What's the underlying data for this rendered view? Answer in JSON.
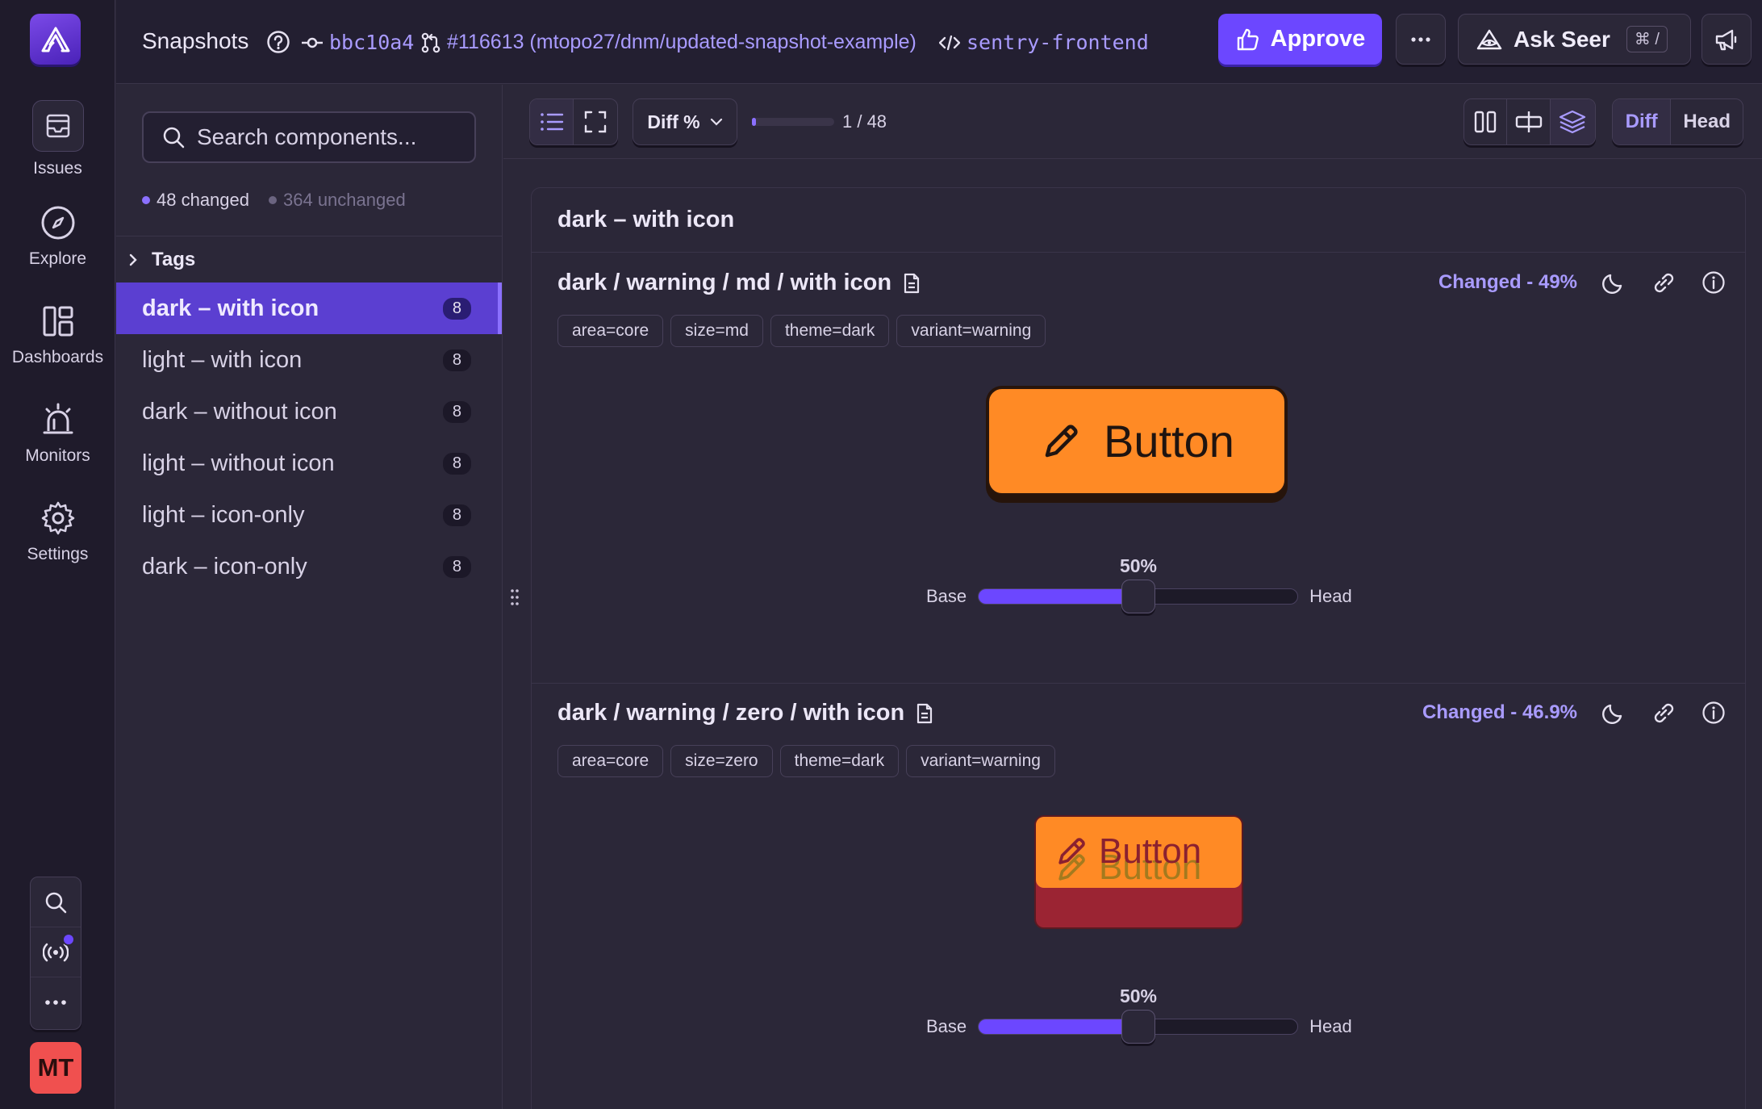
{
  "nav": {
    "items": [
      {
        "label": "Issues",
        "icon": "inbox-icon"
      },
      {
        "label": "Explore",
        "icon": "compass-icon"
      },
      {
        "label": "Dashboards",
        "icon": "dashboard-icon"
      },
      {
        "label": "Monitors",
        "icon": "siren-icon"
      },
      {
        "label": "Settings",
        "icon": "gear-icon"
      }
    ],
    "avatar_initials": "MT"
  },
  "header": {
    "title": "Snapshots",
    "commit": "bbc10a4",
    "pr": "#116613 (mtopo27/dnm/updated-snapshot-example)",
    "project": "sentry-frontend",
    "approve_label": "Approve",
    "seer_label": "Ask Seer",
    "seer_shortcut": "⌘ /"
  },
  "sidebar": {
    "search_placeholder": "Search components...",
    "changed_count": "48 changed",
    "unchanged_count": "364 unchanged",
    "tags_label": "Tags",
    "components": [
      {
        "label": "dark – with icon",
        "count": "8",
        "active": true
      },
      {
        "label": "light – with icon",
        "count": "8"
      },
      {
        "label": "dark – without icon",
        "count": "8"
      },
      {
        "label": "light – without icon",
        "count": "8"
      },
      {
        "label": "light – icon-only",
        "count": "8"
      },
      {
        "label": "dark – icon-only",
        "count": "8"
      }
    ]
  },
  "toolbar": {
    "diff_select": "Diff %",
    "position": "1 / 48",
    "progress_fraction": 0.02,
    "tab_diff": "Diff",
    "tab_head": "Head"
  },
  "group": {
    "title": "dark – with icon",
    "snapshots": [
      {
        "title": "dark / warning / md / with icon",
        "changed": "Changed - 49%",
        "chips": [
          "area=core",
          "size=md",
          "theme=dark",
          "variant=warning"
        ],
        "preview_button": "Button",
        "slider_pct": "50%",
        "slider_value": 0.5,
        "base_label": "Base",
        "head_label": "Head"
      },
      {
        "title": "dark / warning / zero / with icon",
        "changed": "Changed - 46.9%",
        "chips": [
          "area=core",
          "size=zero",
          "theme=dark",
          "variant=warning"
        ],
        "preview_button": "Button",
        "slider_pct": "50%",
        "slider_value": 0.5,
        "base_label": "Base",
        "head_label": "Head"
      }
    ]
  },
  "colors": {
    "accent": "#6c47ff",
    "accent_text": "#a99bff",
    "warning_button": "#ff8a25",
    "diff_red": "#9b2433",
    "avatar": "#f0504f"
  }
}
